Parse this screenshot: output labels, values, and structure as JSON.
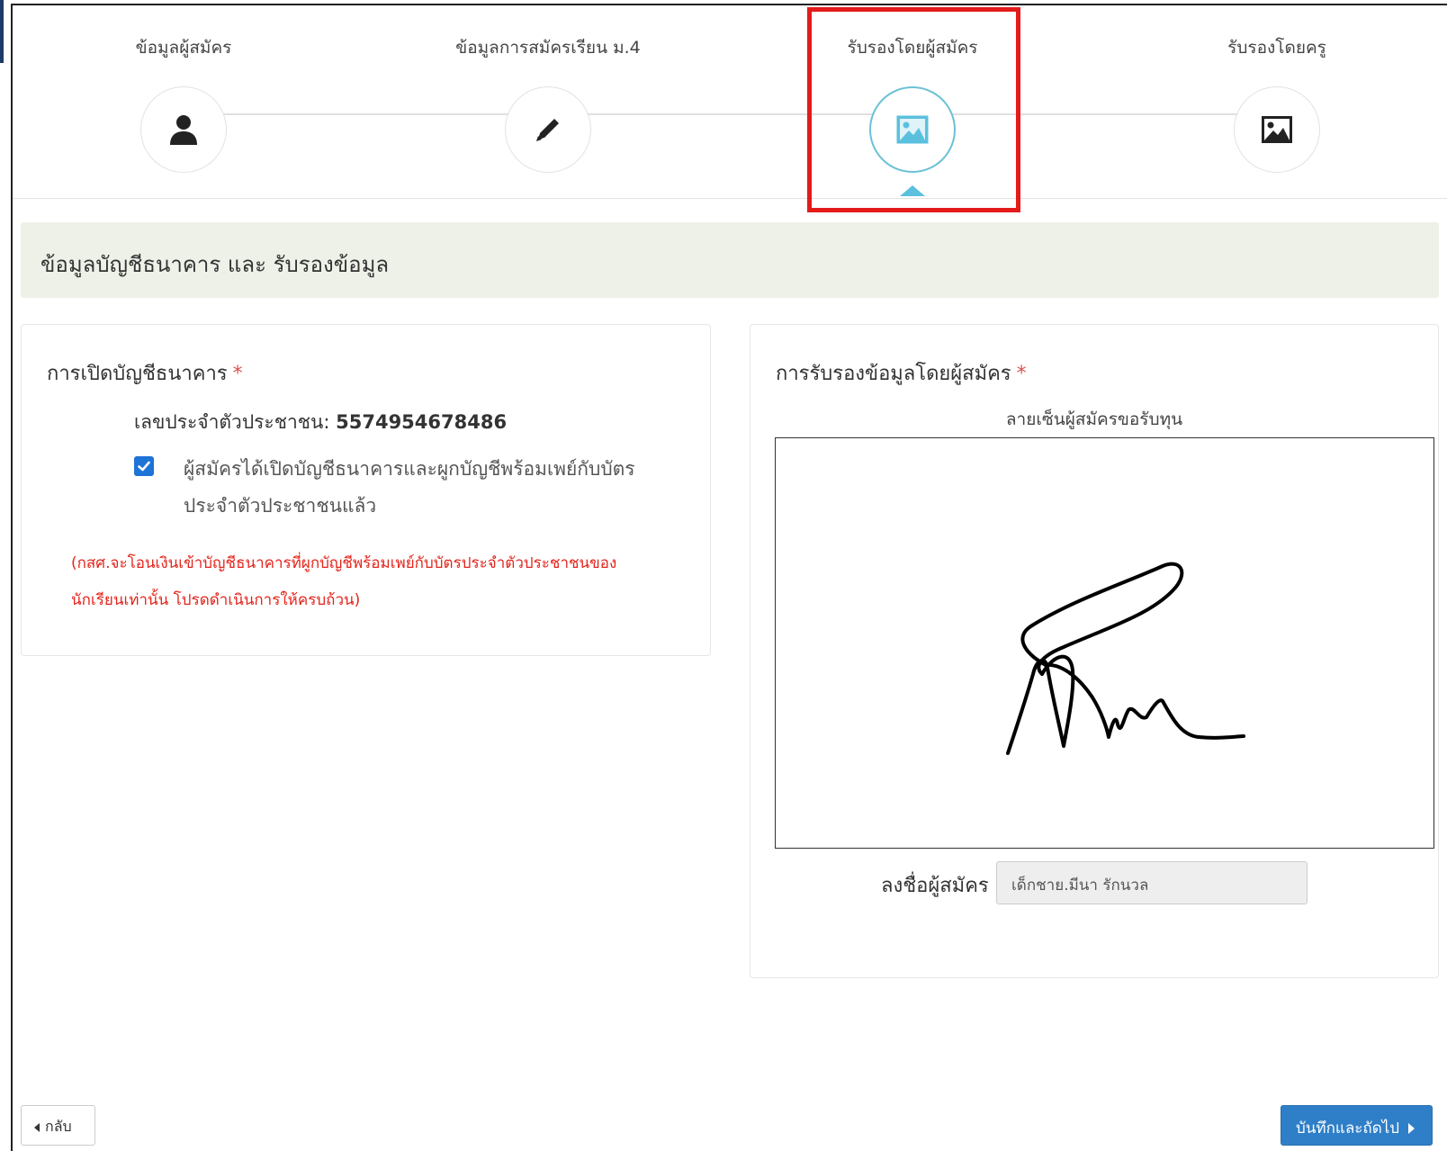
{
  "steps": [
    {
      "label": "ข้อมูลผู้สมัคร",
      "icon": "user-icon"
    },
    {
      "label": "ข้อมูลการสมัครเรียน ม.4",
      "icon": "pencil-icon"
    },
    {
      "label": "รับรองโดยผู้สมัคร",
      "icon": "image-icon",
      "active": true
    },
    {
      "label": "รับรองโดยครู",
      "icon": "image-icon"
    }
  ],
  "section": {
    "title": "ข้อมูลบัญชีธนาคาร และ รับรองข้อมูล"
  },
  "bank": {
    "title": "การเปิดบัญชีธนาคาร",
    "required_mark": "*",
    "id_label": "เลขประจำตัวประชาชน:",
    "id_value": "5574954678486",
    "checkbox_checked": true,
    "checkbox_label": "ผู้สมัครได้เปิดบัญชีธนาคารและผูกบัญชีพร้อมเพย์กับบัตรประจำตัวประชาชนแล้ว",
    "warning": "(กสศ.จะโอนเงินเข้าบัญชีธนาคารที่ผูกบัญชีพร้อมเพย์กับบัตรประจำตัวประชาชนของนักเรียนเท่านั้น โปรดดำเนินการให้ครบถ้วน)"
  },
  "certify": {
    "title": "การรับรองข้อมูลโดยผู้สมัคร",
    "required_mark": "*",
    "signature_caption": "ลายเซ็นผู้สมัครขอรับทุน",
    "signer_label": "ลงชื่อผู้สมัคร",
    "signer_value": "เด็กชาย.มีนา รักนวล"
  },
  "buttons": {
    "back": "กลับ",
    "next": "บันทึกและถัดไป"
  },
  "colors": {
    "active_step": "#5bc0de",
    "highlight": "#e41b1b",
    "primary": "#2f7fc8",
    "warning_text": "#e3241b"
  }
}
